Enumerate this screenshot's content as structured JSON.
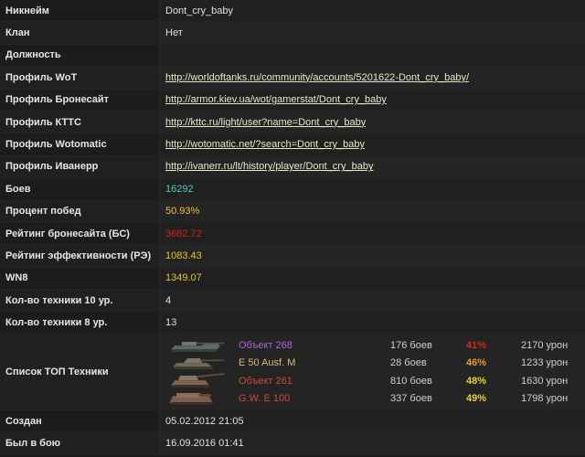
{
  "rows": [
    {
      "label": "Никнейм",
      "value": "Dont_cry_baby"
    },
    {
      "label": "Клан",
      "value": "Нет"
    },
    {
      "label": "Должность",
      "value": ""
    },
    {
      "label": "Профиль WoT",
      "value": "http://worldoftanks.ru/community/accounts/5201622-Dont_cry_baby/"
    },
    {
      "label": "Профиль Бронесайт",
      "value": "http://armor.kiev.ua/wot/gamerstat/Dont_cry_baby"
    },
    {
      "label": "Профиль КТТС",
      "value": "http://kttc.ru/light/user?name=Dont_cry_baby"
    },
    {
      "label": "Профиль Wotomatic",
      "value": "http://wotomatic.net/?search=Dont_cry_baby"
    },
    {
      "label": "Профиль Иванерр",
      "value": "http://ivanerr.ru/lt/history/player/Dont_cry_baby"
    },
    {
      "label": "Боев",
      "value": "16292",
      "color": "#4fc8c3"
    },
    {
      "label": "Процент побед",
      "value": "50.93%",
      "color": "#e4c534"
    },
    {
      "label": "Рейтинг бронесайта (БС)",
      "value": "3682.72",
      "color": "#d1241a"
    },
    {
      "label": "Рейтинг эффективности (РЭ)",
      "value": "1083.43",
      "color": "#e4c534"
    },
    {
      "label": "WN8",
      "value": "1349.07",
      "color": "#e4c534"
    },
    {
      "label": "Кол-во техники 10 ур.",
      "value": "4"
    },
    {
      "label": "Кол-во техники 8 ур.",
      "value": "13"
    }
  ],
  "top_tanks": {
    "label": "Список ТОП Техники",
    "items": [
      {
        "name": "Объект 268",
        "battles": "176 боев",
        "winrate": "41%",
        "damage": "2170 урон",
        "name_color": "#a96ad6",
        "wr_color": "#d32a1a",
        "icon": "tank-destroyer-icon"
      },
      {
        "name": "E 50 Ausf. M",
        "battles": "28 боев",
        "winrate": "46%",
        "damage": "1233 урон",
        "name_color": "#d3bd7a",
        "wr_color": "#e89a2c",
        "icon": "medium-tank-icon"
      },
      {
        "name": "Объект 261",
        "battles": "810 боев",
        "winrate": "48%",
        "damage": "1630 урон",
        "name_color": "#c84a40",
        "wr_color": "#e6d02a",
        "icon": "artillery-icon"
      },
      {
        "name": "G.W. E 100",
        "battles": "337 боев",
        "winrate": "49%",
        "damage": "1798 урон",
        "name_color": "#c84a40",
        "wr_color": "#e6d02a",
        "icon": "artillery-icon"
      }
    ]
  },
  "footer_rows": [
    {
      "label": "Создан",
      "value": "05.02.2012 21:05"
    },
    {
      "label": "Был в бою",
      "value": "16.09.2016 01:41"
    }
  ]
}
